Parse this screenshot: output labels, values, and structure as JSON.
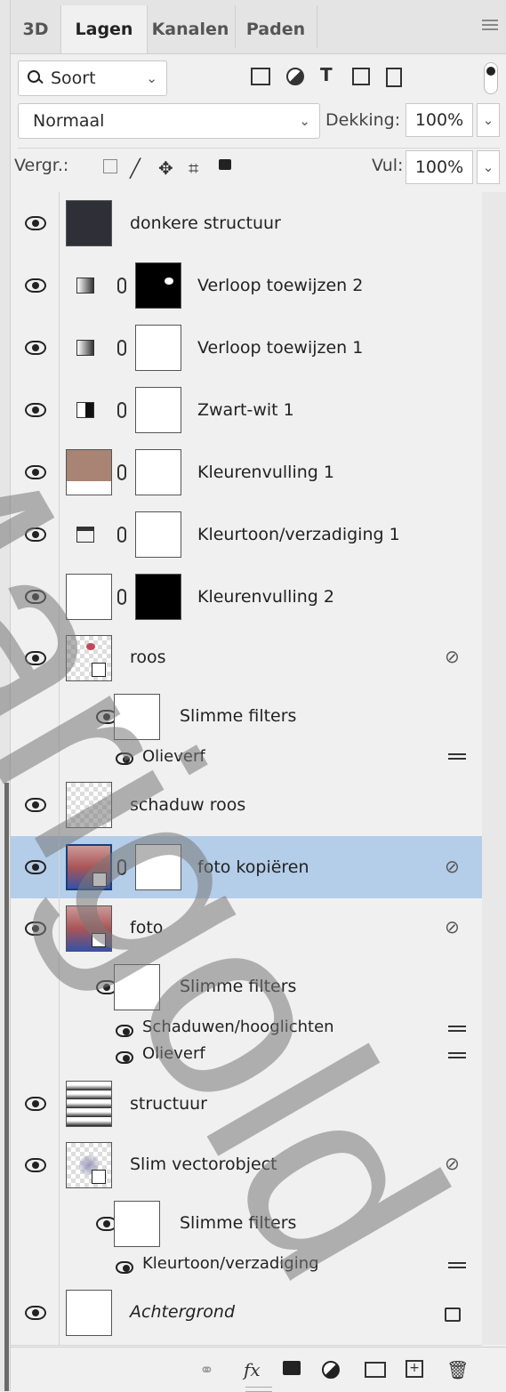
{
  "tabs": [
    "3D",
    "Lagen",
    "Kanalen",
    "Paden"
  ],
  "filter": {
    "label": "Soort",
    "icons": [
      "image-icon",
      "adjustment-icon",
      "type-icon",
      "shape-icon",
      "smartobject-icon"
    ]
  },
  "blend": {
    "mode": "Normaal",
    "opacity_label": "Dekking:",
    "opacity": "100%"
  },
  "lock": {
    "label": "Vergr.:",
    "fill_label": "Vul:",
    "fill": "100%"
  },
  "layers": [
    {
      "name": "donkere structuur"
    },
    {
      "name": "Verloop toewijzen 2"
    },
    {
      "name": "Verloop toewijzen 1"
    },
    {
      "name": "Zwart-wit 1"
    },
    {
      "name": "Kleurenvulling 1"
    },
    {
      "name": "Kleurtoon/verzadiging 1"
    },
    {
      "name": "Kleurenvulling 2"
    },
    {
      "name": "roos",
      "smart_filters": "Slimme filters",
      "filters": [
        "Olieverf"
      ]
    },
    {
      "name": "schaduw roos"
    },
    {
      "name": "foto kopiëren",
      "selected": true
    },
    {
      "name": "foto",
      "smart_filters": "Slimme filters",
      "filters": [
        "Schaduwen/hooglichten",
        "Olieverf"
      ]
    },
    {
      "name": "structuur"
    },
    {
      "name": "Slim vectorobject",
      "smart_filters": "Slimme filters",
      "filters": [
        "Kleurtoon/verzadiging"
      ]
    },
    {
      "name": "Achtergrond"
    }
  ],
  "watermark": "Marigold",
  "colors": {
    "selected": "#b4cde8",
    "panel": "#f0f0f0"
  }
}
